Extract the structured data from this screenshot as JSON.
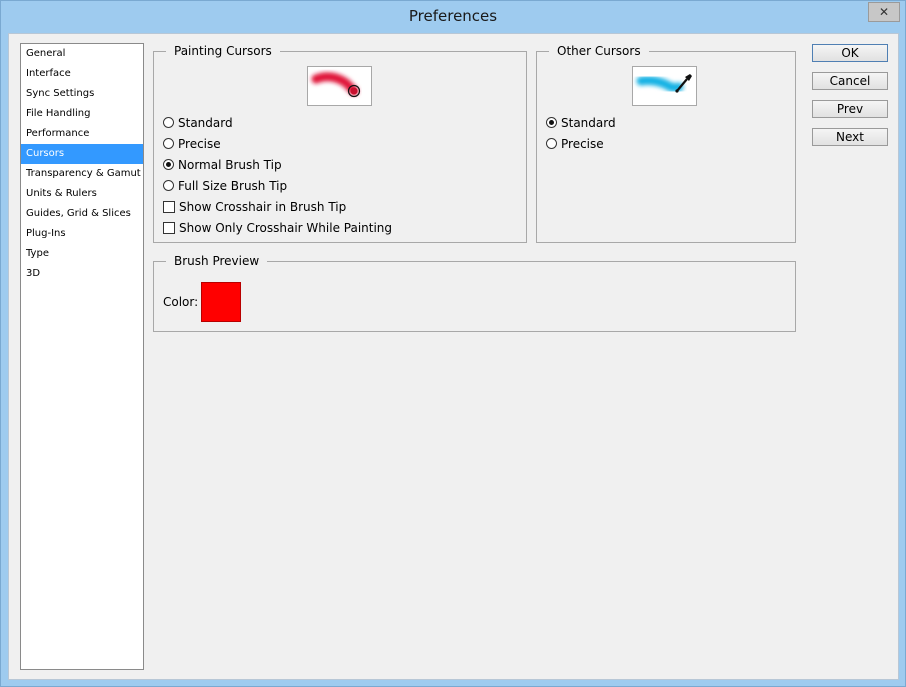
{
  "window": {
    "title": "Preferences",
    "close_glyph": "✕"
  },
  "sidebar": {
    "items": [
      {
        "label": "General"
      },
      {
        "label": "Interface"
      },
      {
        "label": "Sync Settings"
      },
      {
        "label": "File Handling"
      },
      {
        "label": "Performance"
      },
      {
        "label": "Cursors",
        "selected": true
      },
      {
        "label": "Transparency & Gamut"
      },
      {
        "label": "Units & Rulers"
      },
      {
        "label": "Guides, Grid & Slices"
      },
      {
        "label": "Plug-Ins"
      },
      {
        "label": "Type"
      },
      {
        "label": "3D"
      }
    ]
  },
  "painting_cursors": {
    "title": "Painting Cursors",
    "options": [
      {
        "label": "Standard",
        "selected": false
      },
      {
        "label": "Precise",
        "selected": false
      },
      {
        "label": "Normal Brush Tip",
        "selected": true
      },
      {
        "label": "Full Size Brush Tip",
        "selected": false
      }
    ],
    "checkboxes": [
      {
        "label": "Show Crosshair in Brush Tip",
        "checked": false
      },
      {
        "label": "Show Only Crosshair While Painting",
        "checked": false
      }
    ],
    "preview_color": "#e0163a"
  },
  "other_cursors": {
    "title": "Other Cursors",
    "options": [
      {
        "label": "Standard",
        "selected": true
      },
      {
        "label": "Precise",
        "selected": false
      }
    ],
    "preview_color": "#17b2e4"
  },
  "brush_preview": {
    "title": "Brush Preview",
    "color_label": "Color:",
    "color": "#ff0000"
  },
  "buttons": {
    "ok": "OK",
    "cancel": "Cancel",
    "prev": "Prev",
    "next": "Next"
  },
  "colors": {
    "selection": "#3399ff",
    "titlebar": "#9ecbef"
  }
}
